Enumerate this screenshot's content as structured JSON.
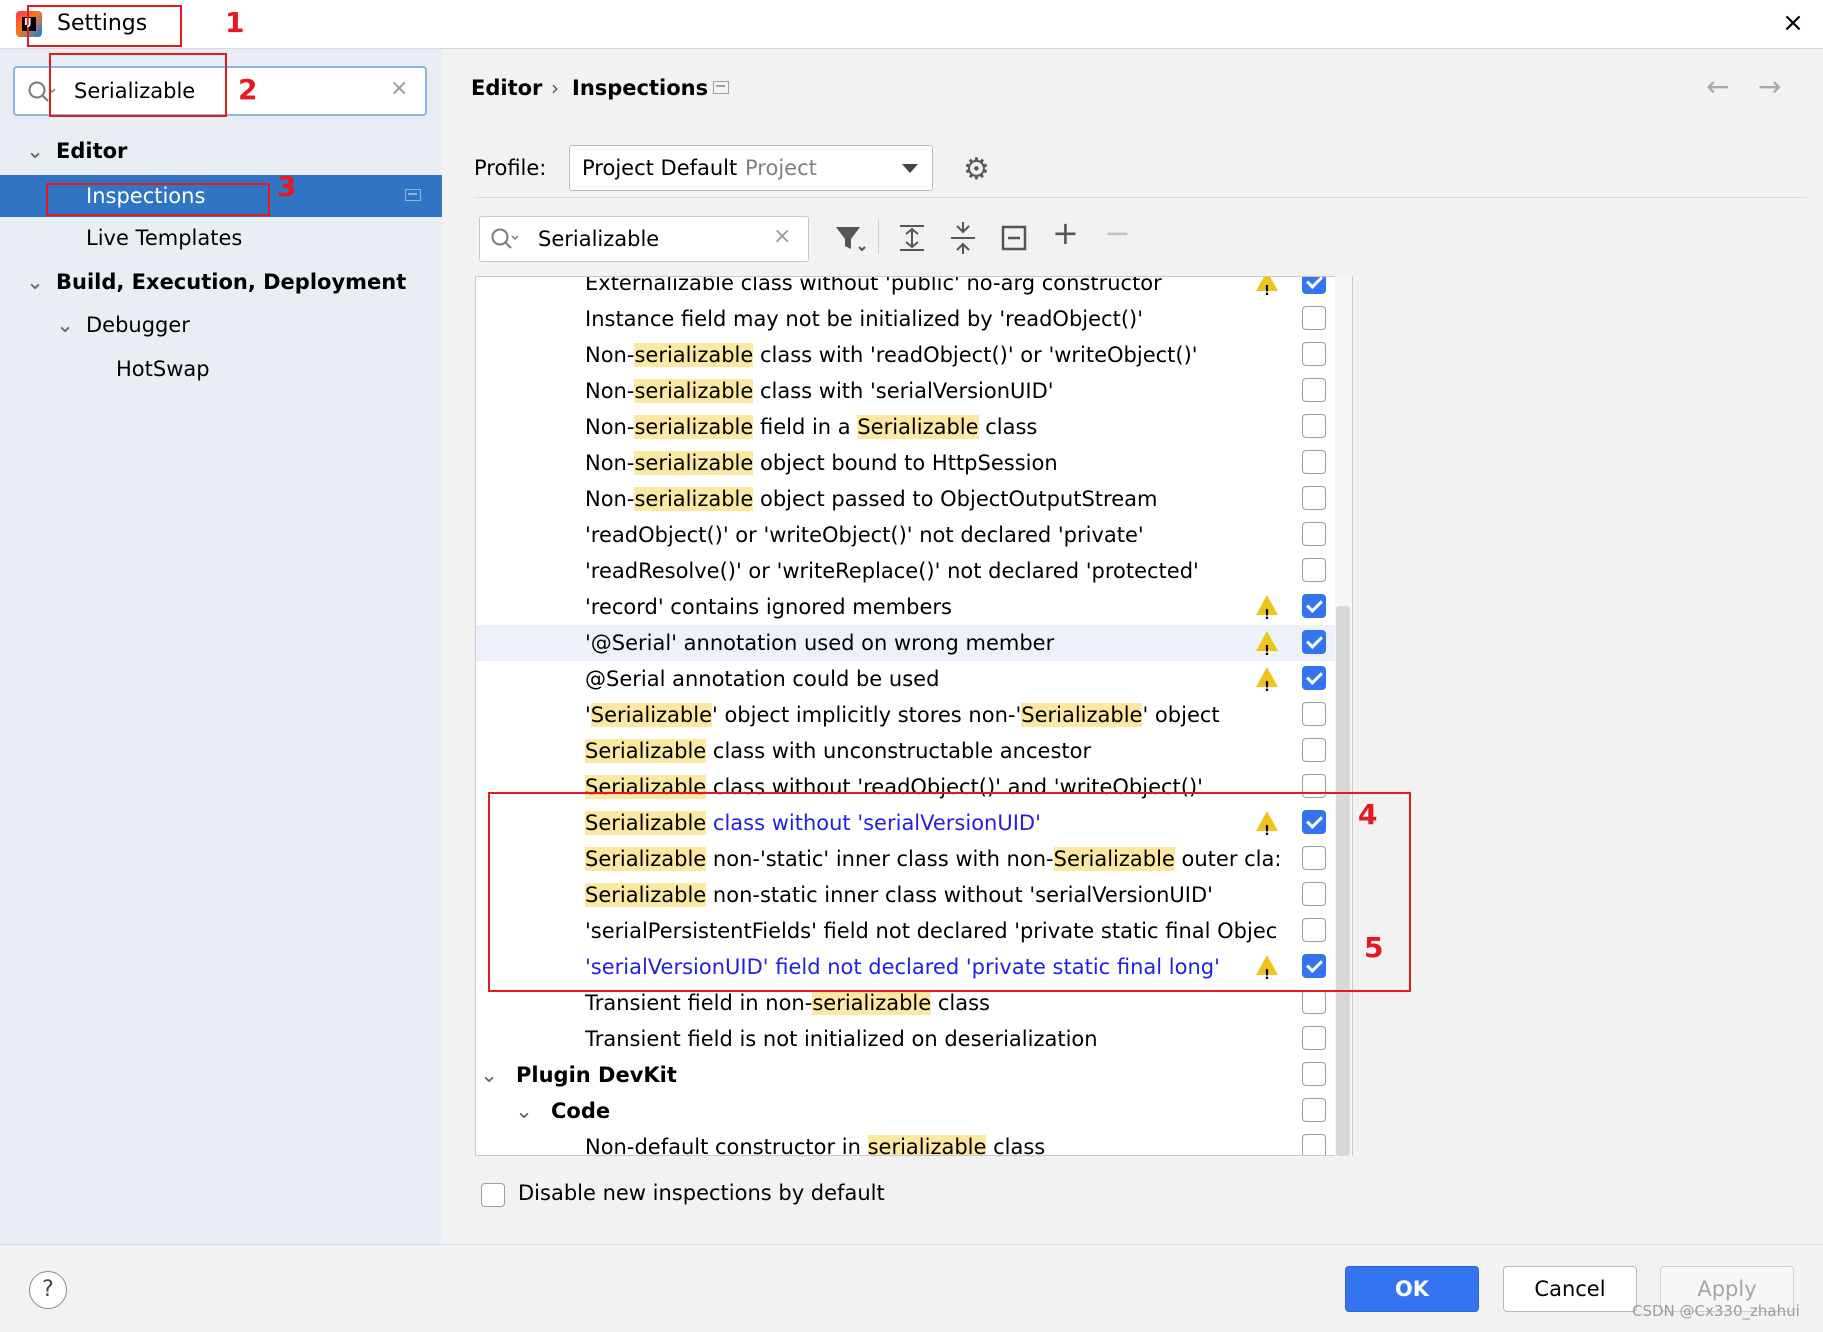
{
  "window": {
    "title": "Settings",
    "close_glyph": "×"
  },
  "sidebar": {
    "search": {
      "value": "Serializable",
      "clear_glyph": "×"
    },
    "tree": [
      {
        "label": "Editor",
        "expanded": true
      },
      {
        "label": "Inspections",
        "selected": true
      },
      {
        "label": "Live Templates"
      },
      {
        "label": "Build, Execution, Deployment",
        "expanded": true
      },
      {
        "label": "Debugger",
        "expanded": true
      },
      {
        "label": "HotSwap"
      }
    ]
  },
  "breadcrumb": {
    "parent": "Editor",
    "sep": "›",
    "current": "Inspections"
  },
  "nav": {
    "back": "←",
    "forward": "→"
  },
  "profile": {
    "label": "Profile:",
    "value": "Project Default",
    "scope": "Project"
  },
  "filter": {
    "value": "Serializable",
    "clear_glyph": "×"
  },
  "toolbar": {
    "icons": [
      "filter-icon",
      "expand-all-icon",
      "collapse-all-icon",
      "reset-icon",
      "add-icon",
      "remove-icon"
    ],
    "add_glyph": "+",
    "remove_glyph": "−"
  },
  "inspections": {
    "rows": [
      {
        "segments": [
          {
            "t": "Externalizable class without 'public' no-arg constructor"
          }
        ],
        "warn": true,
        "checked": true
      },
      {
        "segments": [
          {
            "t": "Instance field may not be initialized by 'readObject()'"
          }
        ],
        "checked": false
      },
      {
        "segments": [
          {
            "t": "Non-"
          },
          {
            "t": "serializable",
            "hl": true
          },
          {
            "t": " class with 'readObject()' or 'writeObject()'"
          }
        ],
        "checked": false
      },
      {
        "segments": [
          {
            "t": "Non-"
          },
          {
            "t": "serializable",
            "hl": true
          },
          {
            "t": " class with 'serialVersionUID'"
          }
        ],
        "checked": false
      },
      {
        "segments": [
          {
            "t": "Non-"
          },
          {
            "t": "serializable",
            "hl": true
          },
          {
            "t": " field in a "
          },
          {
            "t": "Serializable",
            "hl": true
          },
          {
            "t": " class"
          }
        ],
        "checked": false
      },
      {
        "segments": [
          {
            "t": "Non-"
          },
          {
            "t": "serializable",
            "hl": true
          },
          {
            "t": " object bound to HttpSession"
          }
        ],
        "checked": false
      },
      {
        "segments": [
          {
            "t": "Non-"
          },
          {
            "t": "serializable",
            "hl": true
          },
          {
            "t": " object passed to ObjectOutputStream"
          }
        ],
        "checked": false
      },
      {
        "segments": [
          {
            "t": "'readObject()' or 'writeObject()' not declared 'private'"
          }
        ],
        "checked": false
      },
      {
        "segments": [
          {
            "t": "'readResolve()' or 'writeReplace()' not declared 'protected'"
          }
        ],
        "checked": false
      },
      {
        "segments": [
          {
            "t": "'record' contains ignored members"
          }
        ],
        "warn": true,
        "checked": true
      },
      {
        "segments": [
          {
            "t": "'@Serial' annotation used on wrong member"
          }
        ],
        "warn": true,
        "checked": true,
        "hover": true
      },
      {
        "segments": [
          {
            "t": "@Serial annotation could be used"
          }
        ],
        "warn": true,
        "checked": true
      },
      {
        "segments": [
          {
            "t": "'"
          },
          {
            "t": "Serializable",
            "hl": true
          },
          {
            "t": "' object implicitly stores non-'"
          },
          {
            "t": "Serializable",
            "hl": true
          },
          {
            "t": "' object"
          }
        ],
        "checked": false
      },
      {
        "segments": [
          {
            "t": "Serializable",
            "hl": true
          },
          {
            "t": " class with unconstructable ancestor"
          }
        ],
        "checked": false
      },
      {
        "segments": [
          {
            "t": "Serializable",
            "hl": true
          },
          {
            "t": " class without 'readObject()' and 'writeObject()'"
          }
        ],
        "checked": false
      },
      {
        "segments": [
          {
            "t": "Serializable",
            "hl": true
          },
          {
            "t": " class without 'serialVersionUID'",
            "blue": true
          }
        ],
        "warn": true,
        "checked": true
      },
      {
        "segments": [
          {
            "t": "Serializable",
            "hl": true
          },
          {
            "t": " non-'static' inner class with non-"
          },
          {
            "t": "Serializable",
            "hl": true
          },
          {
            "t": " outer cla:"
          }
        ],
        "checked": false
      },
      {
        "segments": [
          {
            "t": "Serializable",
            "hl": true
          },
          {
            "t": " non-static inner class without 'serialVersionUID'"
          }
        ],
        "checked": false
      },
      {
        "segments": [
          {
            "t": "'serialPersistentFields' field not declared 'private static final Objec"
          }
        ],
        "checked": false
      },
      {
        "segments": [
          {
            "t": "'serialVersionUID' field not declared 'private static final long'",
            "blue": true
          }
        ],
        "warn": true,
        "checked": true
      },
      {
        "segments": [
          {
            "t": "Transient field in non-"
          },
          {
            "t": "serializable",
            "hl": true
          },
          {
            "t": " class"
          }
        ],
        "checked": false
      },
      {
        "segments": [
          {
            "t": "Transient field is not initialized on deserialization"
          }
        ],
        "checked": false
      },
      {
        "segments": [
          {
            "t": "Plugin DevKit",
            "bold": true
          }
        ],
        "level": 0,
        "chevron": true,
        "checked": false
      },
      {
        "segments": [
          {
            "t": "Code",
            "bold": true
          }
        ],
        "level": 1,
        "chevron": true,
        "checked": false
      },
      {
        "segments": [
          {
            "t": "Non-default constructor in "
          },
          {
            "t": "serializable",
            "hl": true
          },
          {
            "t": " class"
          }
        ],
        "checked": false
      }
    ]
  },
  "disable_new": {
    "label": "Disable new inspections by default",
    "checked": false
  },
  "footer": {
    "help": "?",
    "ok": "OK",
    "cancel": "Cancel",
    "apply": "Apply"
  },
  "annotations": [
    "1",
    "2",
    "3",
    "4",
    "5"
  ],
  "watermark": "CSDN @Cx330_zhahui",
  "colors": {
    "accent": "#3574f0",
    "selection": "#2f75c4",
    "highlight": "#fce8a0",
    "annotation": "#e5191f",
    "link": "#2222dd",
    "warning": "#f0c419"
  }
}
